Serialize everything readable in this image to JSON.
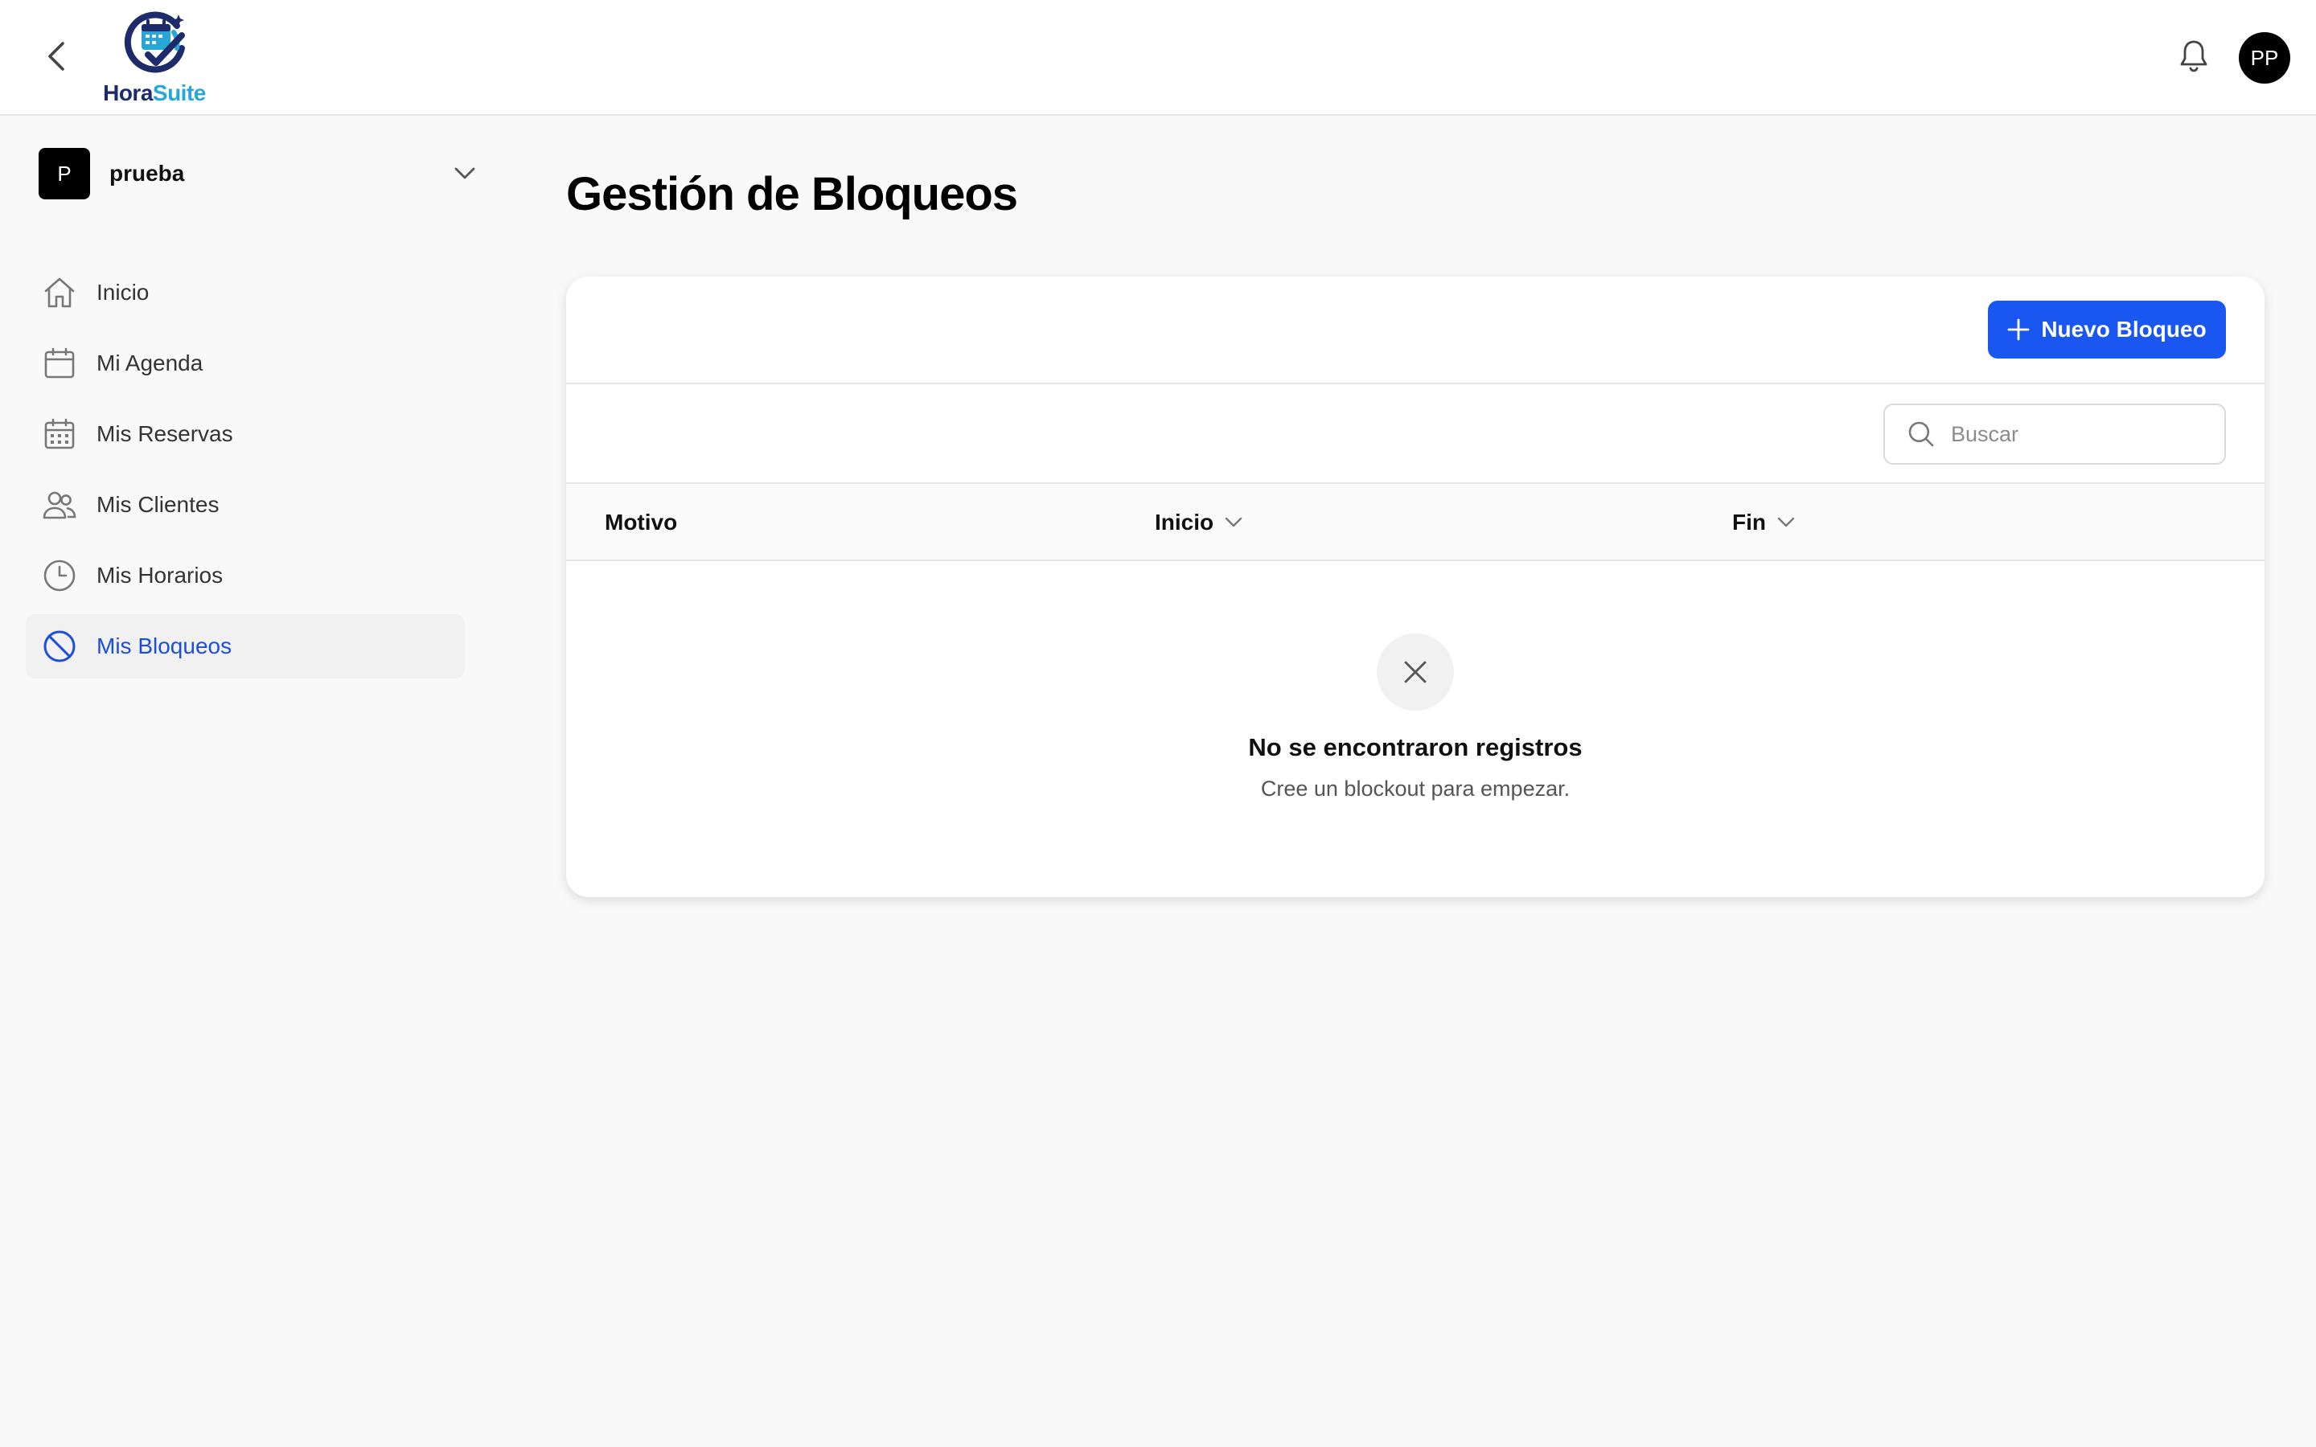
{
  "header": {
    "logo": {
      "text_primary": "Hora",
      "text_secondary": "Suite"
    },
    "avatar_initials": "PP"
  },
  "sidebar": {
    "workspace": {
      "badge": "P",
      "name": "prueba"
    },
    "items": [
      {
        "label": "Inicio",
        "icon": "home-icon"
      },
      {
        "label": "Mi Agenda",
        "icon": "calendar-icon"
      },
      {
        "label": "Mis Reservas",
        "icon": "calendar-grid-icon"
      },
      {
        "label": "Mis Clientes",
        "icon": "users-icon"
      },
      {
        "label": "Mis Horarios",
        "icon": "clock-icon"
      },
      {
        "label": "Mis Bloqueos",
        "icon": "block-icon",
        "active": true
      }
    ]
  },
  "main": {
    "title": "Gestión de Bloqueos",
    "new_button_label": "Nuevo Bloqueo",
    "search_placeholder": "Buscar",
    "columns": [
      {
        "label": "Motivo",
        "sortable": false
      },
      {
        "label": "Inicio",
        "sortable": true
      },
      {
        "label": "Fin",
        "sortable": true
      }
    ],
    "empty": {
      "title": "No se encontraron registros",
      "subtitle": "Cree un blockout para empezar."
    }
  },
  "colors": {
    "accent": "#1a56f0",
    "active_nav_text": "#1d4ed8",
    "logo_dark": "#1e2b6b",
    "logo_light": "#27a7d8"
  }
}
